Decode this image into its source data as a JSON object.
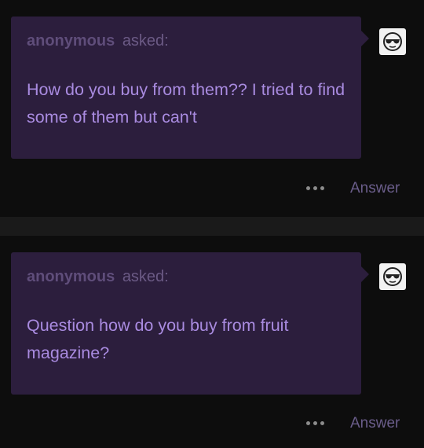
{
  "posts": [
    {
      "asker": "anonymous",
      "asked_label": "asked:",
      "question": "How do you buy from them?? I tried to find some of them but can't",
      "avatar_icon": "sunglasses-face-icon",
      "more_icon": "ellipsis-icon",
      "answer_label": "Answer"
    },
    {
      "asker": "anonymous",
      "asked_label": "asked:",
      "question": "Question how do you buy from fruit magazine?",
      "avatar_icon": "sunglasses-face-icon",
      "more_icon": "ellipsis-icon",
      "answer_label": "Answer"
    }
  ],
  "colors": {
    "background": "#0d0d0d",
    "bubble": "#2c1e3d",
    "question_text": "#a98be0",
    "asker_text": "#5f4d7a",
    "answer_link": "#6a5d8a",
    "divider": "#1a1a1a"
  }
}
